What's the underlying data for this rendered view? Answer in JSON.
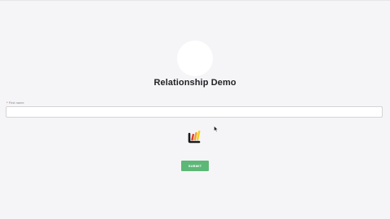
{
  "page": {
    "title": "Relationship Demo"
  },
  "form": {
    "name_field": {
      "required_marker": "*",
      "label": "First name",
      "value": "",
      "placeholder": ""
    },
    "submit_label": "SUBMIT"
  },
  "icons": {
    "avatar": "avatar-circle",
    "logo": "brand-logo-icon",
    "cursor": "mouse-pointer-icon"
  },
  "colors": {
    "background": "#f5f5f7",
    "submit_button": "#5cb876",
    "logo_stripes": [
      "#e03a2f",
      "#f0a020",
      "#f5d020"
    ],
    "logo_frame": "#1a1a1a"
  }
}
